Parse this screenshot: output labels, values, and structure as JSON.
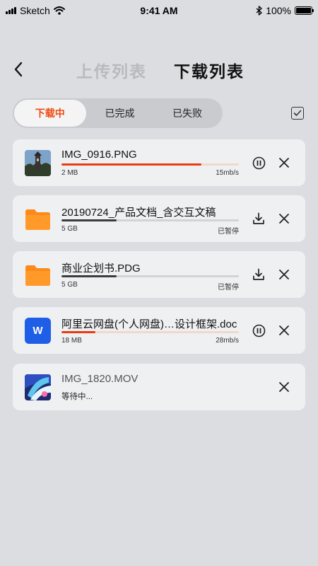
{
  "status_bar": {
    "carrier": "Sketch",
    "time": "9:41 AM",
    "battery": "100%"
  },
  "header": {
    "back_icon": "chevron-left-icon",
    "upload_tab": "上传列表",
    "download_tab": "下载列表"
  },
  "segments": [
    {
      "label": "下载中",
      "active": true
    },
    {
      "label": "已完成",
      "active": false
    },
    {
      "label": "已失败",
      "active": false
    }
  ],
  "select_icon": "checkbox-checked-icon",
  "colors": {
    "accent": "#ee4a10",
    "progress": "#ea3a12",
    "background": "#dcdde1",
    "card": "#eff0f2"
  },
  "items": [
    {
      "name": "IMG_0916.PNG",
      "size": "2 MB",
      "status": "15mb/s",
      "progress": 0.79,
      "state": "downloading",
      "thumb": "photo-thumbnail",
      "action_icon": "pause-icon",
      "close_icon": "close-icon"
    },
    {
      "name": "20190724_产品文档_含交互文稿",
      "size": "5 GB",
      "status": "已暂停",
      "progress": 0.31,
      "state": "paused",
      "thumb": "folder-icon",
      "action_icon": "download-icon",
      "close_icon": "close-icon"
    },
    {
      "name": "商业企划书.PDG",
      "size": "5 GB",
      "status": "已暂停",
      "progress": 0.31,
      "state": "paused",
      "thumb": "folder-icon",
      "action_icon": "download-icon",
      "close_icon": "close-icon"
    },
    {
      "name": "阿里云网盘(个人网盘)…设计框架.doc",
      "size": "18 MB",
      "status": "28mb/s",
      "progress": 0.19,
      "state": "downloading",
      "thumb": "word-doc-icon",
      "thumb_letter": "W",
      "action_icon": "pause-icon",
      "close_icon": "close-icon"
    },
    {
      "name": "IMG_1820.MOV",
      "status": "等待中...",
      "state": "waiting",
      "thumb": "video-thumbnail",
      "close_icon": "close-icon"
    }
  ]
}
